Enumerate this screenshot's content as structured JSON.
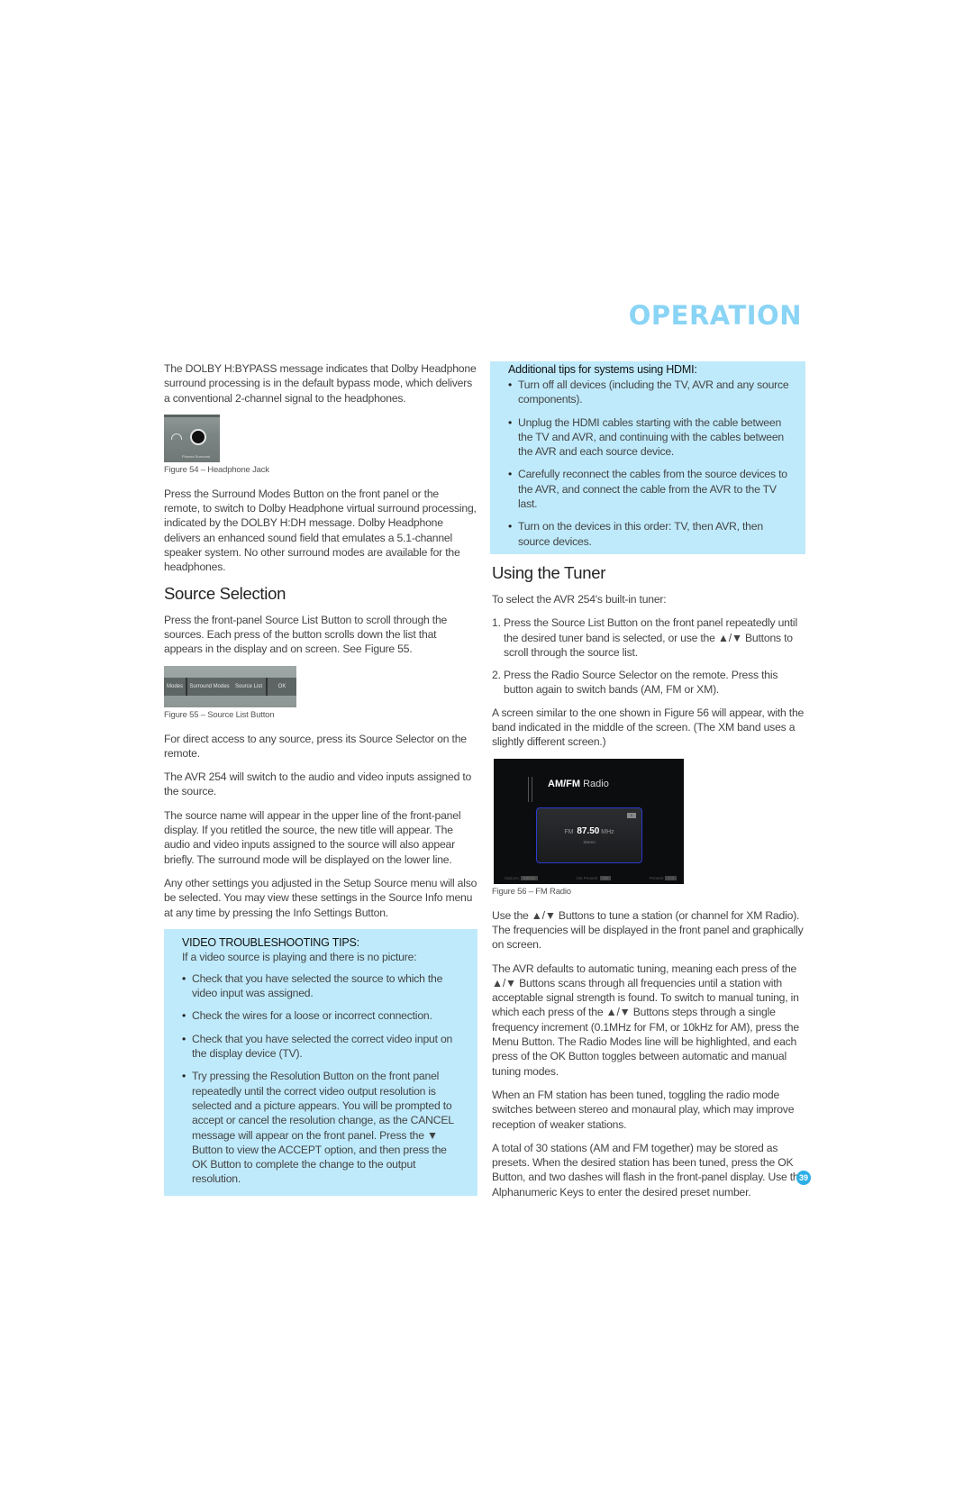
{
  "header": {
    "section_title": "OPERATION"
  },
  "left": {
    "para1": "The DOLBY H:BYPASS message indicates that Dolby Headphone surround processing is in the default bypass mode, which delivers a conventional 2-channel signal to the headphones.",
    "fig54": {
      "caption": "Figure 54 – Headphone Jack",
      "label": "Phones Surround"
    },
    "para2": "Press the Surround Modes Button on the front panel or the remote, to switch to Dolby Headphone virtual surround processing, indicated by the DOLBY H:DH message. Dolby Headphone delivers an enhanced sound field that emulates a 5.1-channel speaker system. No other surround modes are available for the headphones.",
    "source_heading": "Source Selection",
    "para3": "Press the front-panel Source List Button to scroll through the sources. Each press of the button scrolls down the list that appears in the display and on screen. See Figure 55.",
    "fig55": {
      "caption": "Figure 55 – Source List Button",
      "buttons": [
        "Modes",
        "Surround Modes",
        "Source List",
        "OK"
      ]
    },
    "para4": "For direct access to any source, press its Source Selector on the remote.",
    "para5": "The AVR 254 will switch to the audio and video inputs assigned to the source.",
    "para6": "The source name will appear in the upper line of the front-panel display. If you retitled the source, the new title will appear. The audio and video inputs assigned to the source will also appear briefly. The surround mode will be displayed on the lower line.",
    "para7": "Any other settings you adjusted in the Setup Source menu will also be selected. You may view these settings in the Source Info menu at any time by pressing the Info Settings Button.",
    "tips": {
      "title": "VIDEO TROUBLESHOOTING TIPS:",
      "intro": "If a video source is playing and there is no picture:",
      "bullets": [
        "Check that you have selected the source to which the video input was assigned.",
        "Check the wires for a loose or incorrect connection.",
        "Check that you have selected the correct video input on the display device (TV).",
        "Try pressing the Resolution Button on the front panel repeatedly until the correct video output resolution is selected and a picture appears. You will be prompted to accept or cancel the resolution change, as the CANCEL message will appear on the front panel. Press the ▼ Button to view the ACCEPT option, and then press the OK Button to complete the change to the output resolution."
      ]
    }
  },
  "right": {
    "hdmi_tips": {
      "title": "Additional tips for systems using HDMI:",
      "bullets": [
        "Turn off all devices (including the TV, AVR and any source components).",
        "Unplug the HDMI cables starting with the cable between the TV and AVR, and continuing with the cables between the AVR and each source device.",
        "Carefully reconnect the cables from the source devices to the AVR, and connect the cable from the AVR to the TV last.",
        "Turn on the devices in this order: TV, then AVR, then source devices."
      ]
    },
    "tuner_heading": "Using the Tuner",
    "tuner_intro": "To select the AVR 254's built-in tuner:",
    "steps": [
      {
        "num": "1.",
        "text": "Press the Source List Button on the front panel repeatedly until the desired tuner band is selected, or use the ▲/▼ Buttons to scroll through the source list."
      },
      {
        "num": "2.",
        "text": "Press the Radio Source Selector on the remote. Press this button again to switch bands (AM, FM or XM)."
      }
    ],
    "para1": "A screen similar to the one shown in Figure 56 will appear, with the band indicated in the middle of the screen. (The XM band uses a slightly different screen.)",
    "fig56": {
      "caption": "Figure 56 – FM Radio",
      "title_bold": "AM/FM",
      "title_rest": " Radio",
      "band": "FM",
      "frequency": "87.50",
      "unit": "MHz",
      "mode": "Stereo",
      "preset_number": "1",
      "options_label": "Options:",
      "options_key": "MENU",
      "set_presets_label": "Set Presets:",
      "set_presets_key": "OK",
      "presets_label": "Presets:",
      "presets_keys": "< >"
    },
    "para2": "Use the ▲/▼ Buttons to tune a station (or channel for XM Radio). The frequencies will be displayed in the front panel and graphically on screen.",
    "para3": "The AVR defaults to automatic tuning, meaning each press of the ▲/▼ Buttons scans through all frequencies until a station with acceptable signal strength is found. To switch to manual tuning, in which each press of the ▲/▼ Buttons steps through a single frequency increment (0.1MHz for FM, or 10kHz for AM), press the Menu Button. The Radio Modes line will be highlighted, and each press of the OK Button toggles between automatic and manual tuning modes.",
    "para4": "When an FM station has been tuned, toggling the radio mode switches between stereo and monaural play, which may improve reception of weaker stations.",
    "para5": "A total of 30 stations (AM and FM together) may be stored as presets. When the desired station has been tuned, press the OK Button, and two dashes will flash in the front-panel display. Use the Alphanumeric Keys to enter the desired preset number."
  },
  "footer": {
    "page_number": "39"
  }
}
